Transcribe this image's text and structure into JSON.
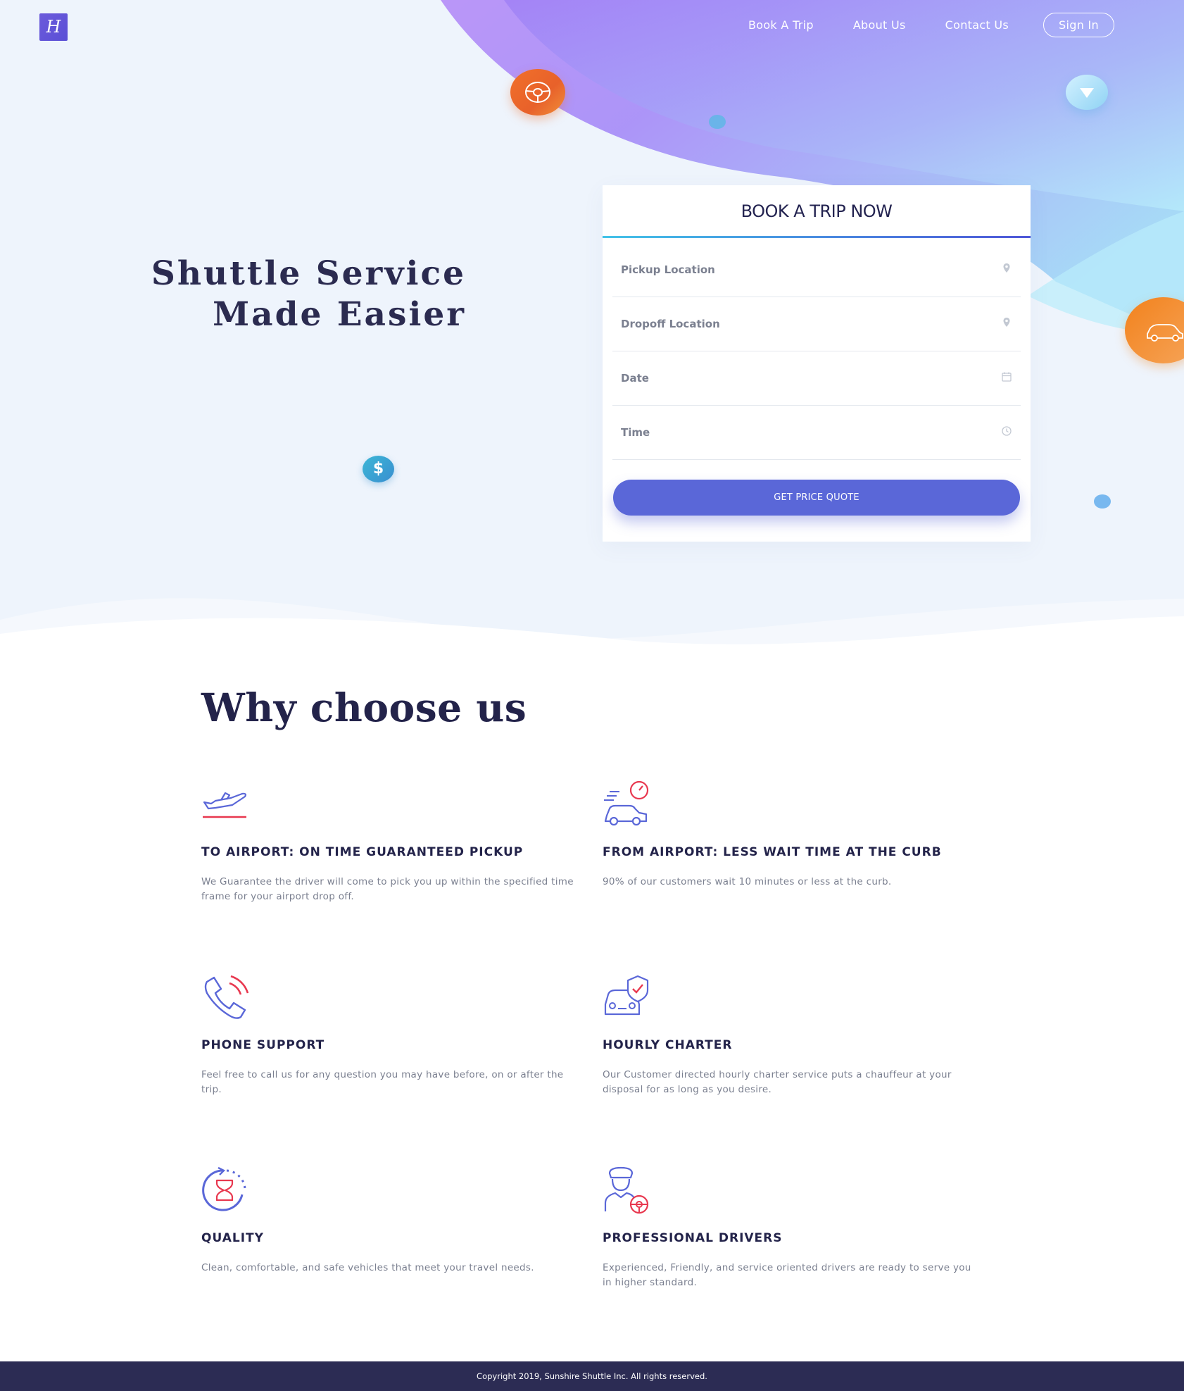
{
  "nav": {
    "book_trip": "Book A Trip",
    "about": "About Us",
    "contact": "Contact Us",
    "sign_in": "Sign In"
  },
  "hero": {
    "title": "Shuttle Service Made Easier",
    "dollar_symbol": "$"
  },
  "booking": {
    "title": "BOOK A TRIP NOW",
    "pickup": "Pickup Location",
    "dropoff": "Dropoff Location",
    "date": "Date",
    "time": "Time",
    "button": "GET PRICE QUOTE"
  },
  "why": {
    "title": "Why choose us",
    "features": [
      {
        "title": "TO AIRPORT: ON TIME GUARANTEED PICKUP",
        "desc": "We Guarantee the driver will come to pick you up within the specified time frame for your airport drop off.",
        "icon": "airplane-icon"
      },
      {
        "title": "FROM AIRPORT: LESS WAIT TIME AT THE CURB",
        "desc": "90% of our customers wait 10 minutes or less at the curb.",
        "icon": "car-speed-icon"
      },
      {
        "title": "PHONE SUPPORT",
        "desc": "Feel free to call us for any question you may have before, on or after the trip.",
        "icon": "phone-icon"
      },
      {
        "title": "HOURLY CHARTER",
        "desc": "Our Customer directed hourly charter service puts a chauffeur at your disposal for as long as you desire.",
        "icon": "car-shield-icon"
      },
      {
        "title": "QUALITY",
        "desc": "Clean, comfortable, and safe vehicles that meet your travel needs.",
        "icon": "hourglass-icon"
      },
      {
        "title": "PROFESSIONAL DRIVERS",
        "desc": "Experienced, Friendly, and service oriented drivers are ready to serve you in higher standard.",
        "icon": "driver-icon"
      }
    ]
  },
  "footer": {
    "copyright": "Copyright 2019, Sunshire Shuttle Inc. All rights reserved."
  },
  "colors": {
    "primary": "#5a67d8",
    "dark": "#2c2c54",
    "accent_red": "#e8384f",
    "orange": "#f1702b"
  }
}
